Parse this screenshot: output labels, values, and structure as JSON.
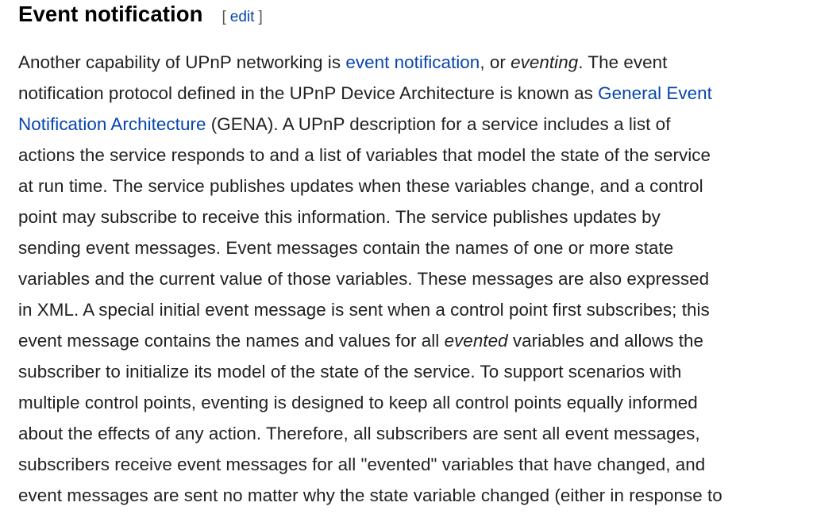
{
  "section": {
    "title": "Event notification",
    "edit_open": "[",
    "edit_label": "edit",
    "edit_close": "]"
  },
  "paragraph": {
    "lines": [
      [
        {
          "t": "Another capability of UPnP networking is "
        },
        {
          "t": "event notification",
          "link": true
        },
        {
          "t": ", or "
        },
        {
          "t": "eventing",
          "em": true
        },
        {
          "t": ". The event"
        }
      ],
      [
        {
          "t": "notification protocol defined in the UPnP Device Architecture is known as "
        },
        {
          "t": "General Event",
          "link": true
        }
      ],
      [
        {
          "t": "Notification Architecture",
          "link": true
        },
        {
          "t": " (GENA). A UPnP description for a service includes a list of"
        }
      ],
      [
        {
          "t": "actions the service responds to and a list of variables that model the state of the service"
        }
      ],
      [
        {
          "t": "at run time. The service publishes updates when these variables change, and a control"
        }
      ],
      [
        {
          "t": "point may subscribe to receive this information. The service publishes updates by"
        }
      ],
      [
        {
          "t": "sending event messages. Event messages contain the names of one or more state"
        }
      ],
      [
        {
          "t": "variables and the current value of those variables. These messages are also expressed"
        }
      ],
      [
        {
          "t": "in XML. A special initial event message is sent when a control point first subscribes; this"
        }
      ],
      [
        {
          "t": "event message contains the names and values for all "
        },
        {
          "t": "evented",
          "em": true
        },
        {
          "t": " variables and allows the"
        }
      ],
      [
        {
          "t": "subscriber to initialize its model of the state of the service. To support scenarios with"
        }
      ],
      [
        {
          "t": "multiple control points, eventing is designed to keep all control points equally informed"
        }
      ],
      [
        {
          "t": "about the effects of any action. Therefore, all subscribers are sent all event messages,"
        }
      ],
      [
        {
          "t": "subscribers receive event messages for all \"evented\" variables that have changed, and"
        }
      ],
      [
        {
          "t": "event messages are sent no matter why the state variable changed (either in response to"
        }
      ]
    ]
  }
}
